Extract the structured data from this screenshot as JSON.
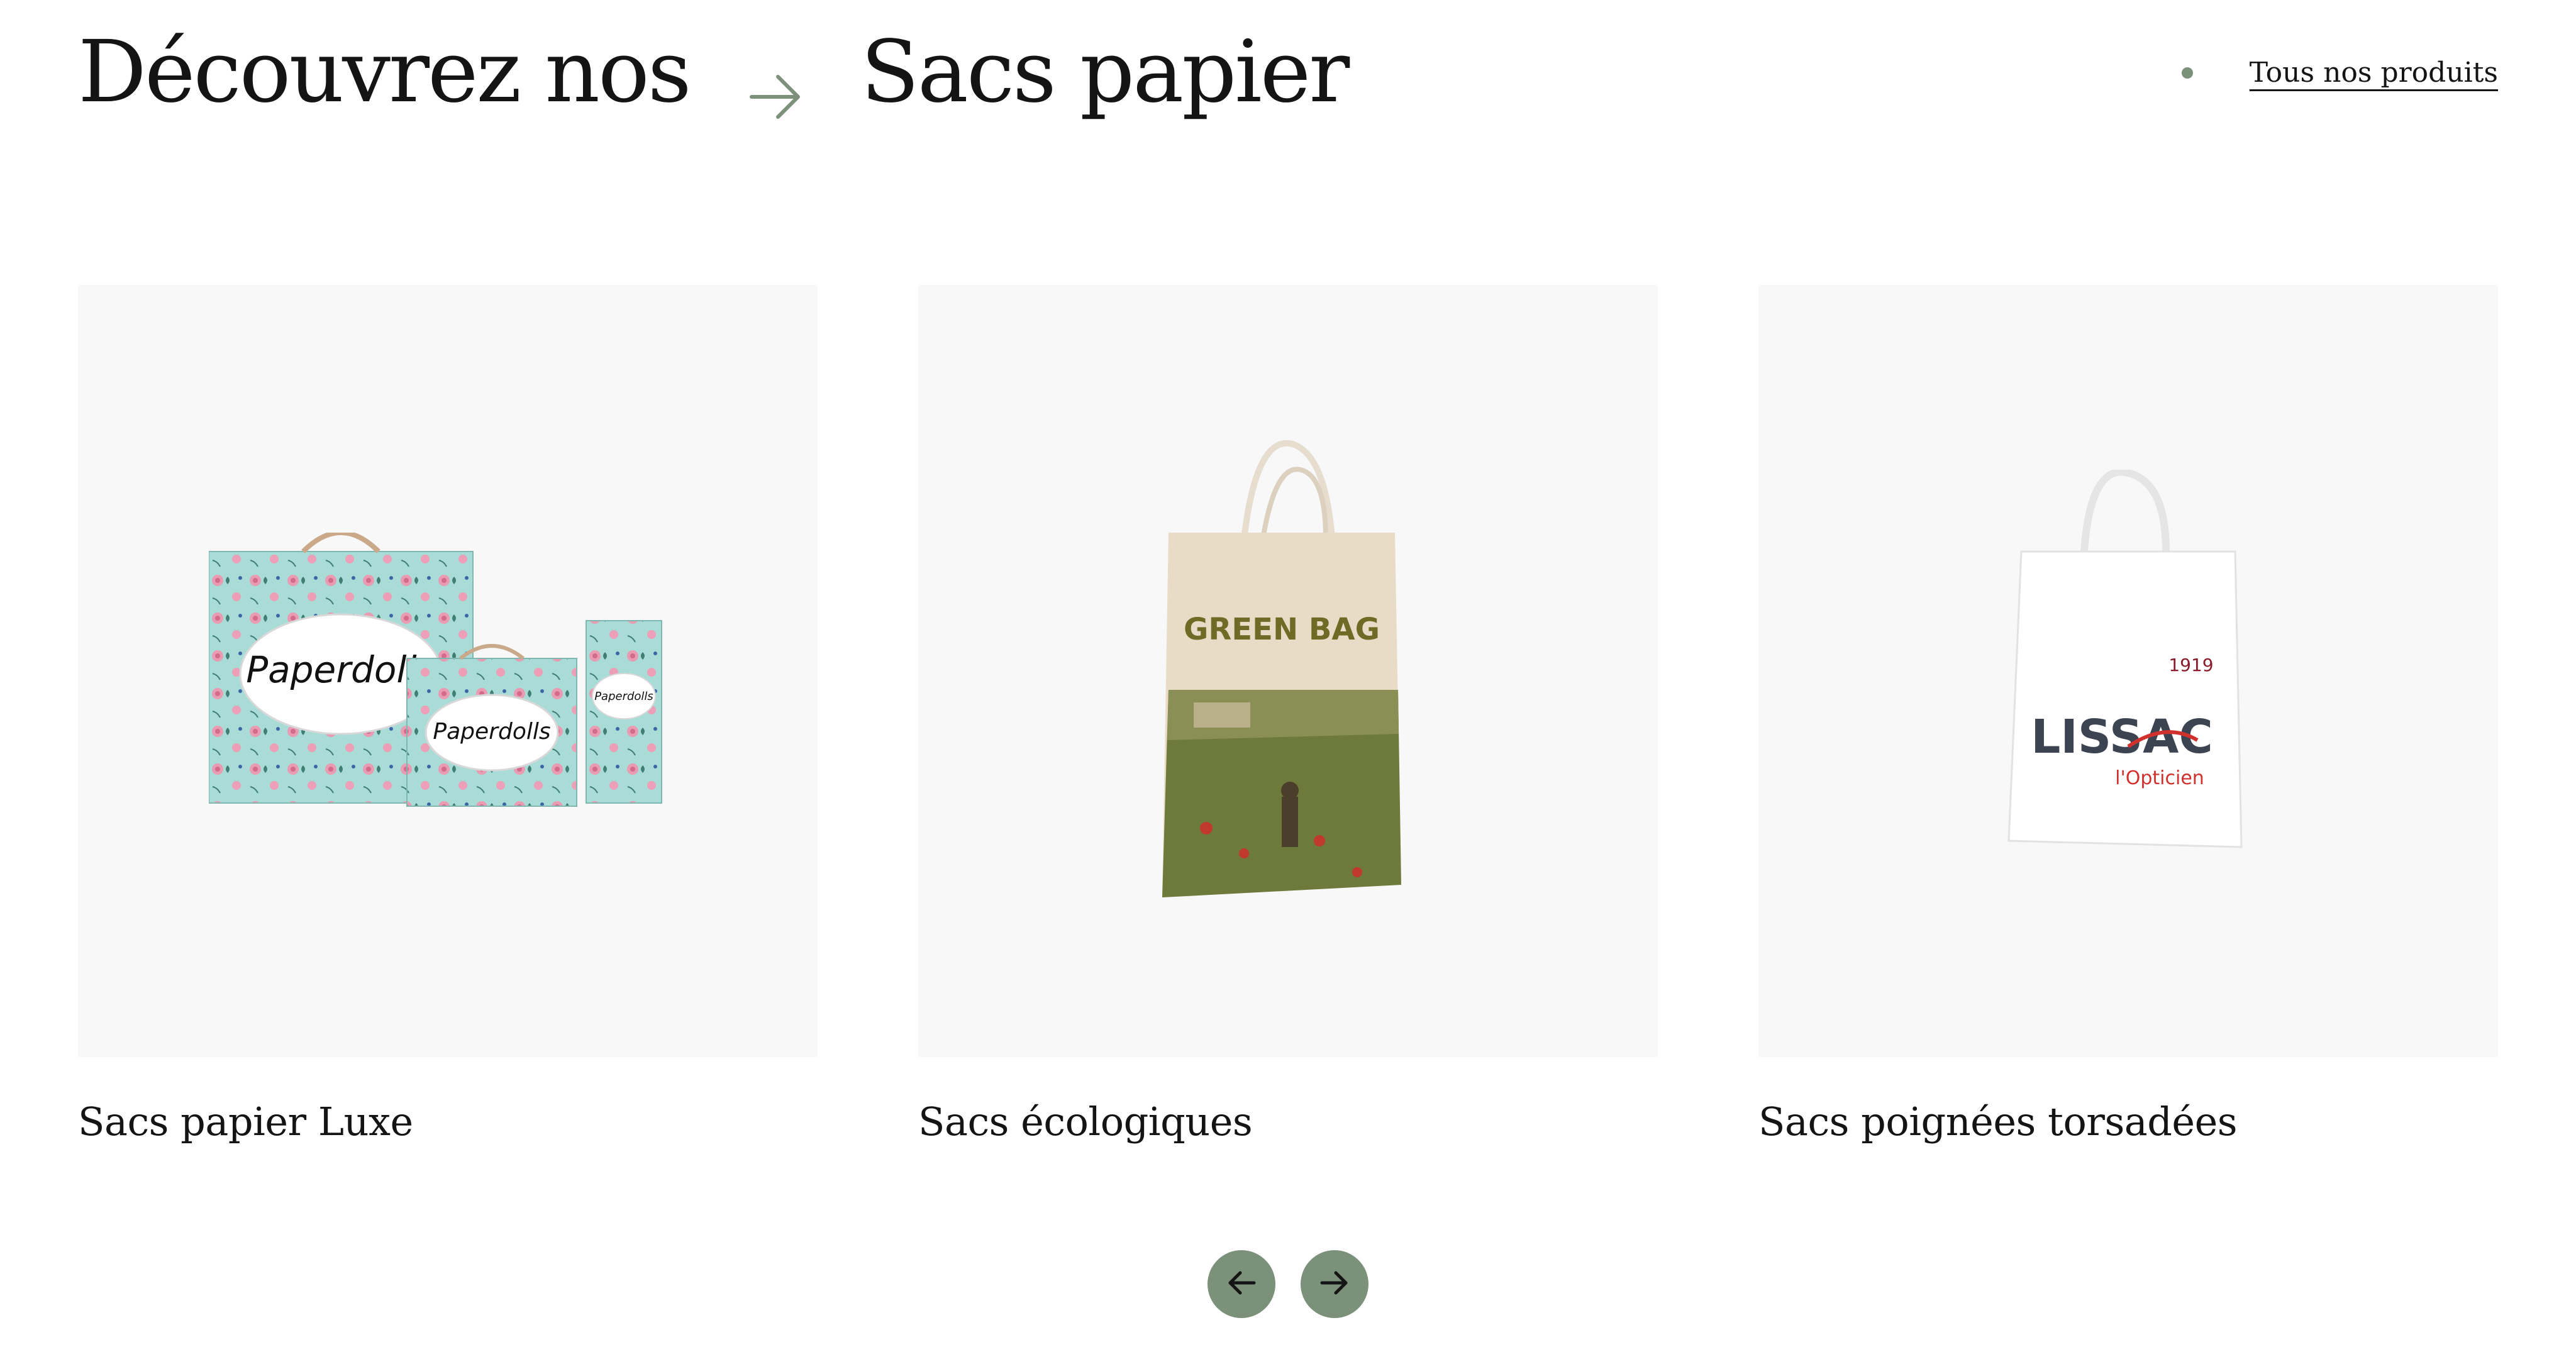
{
  "header": {
    "title_left": "Découvrez nos",
    "title_right": "Sacs papier",
    "arrow_icon": "arrow-right-icon",
    "all_products_label": "Tous nos produits"
  },
  "products": [
    {
      "label": "Sacs papier Luxe",
      "image_brand_large": "Paperdolls",
      "image_brand_medium": "Paperdolls",
      "image_brand_small": "Paperdolls"
    },
    {
      "label": "Sacs écologiques",
      "image_brand": "GREEN BAG"
    },
    {
      "label": "Sacs poignées torsadées",
      "image_brand": "LISSAC",
      "image_tagline": "l'Opticien",
      "image_year": "1919"
    }
  ],
  "navigation": {
    "prev_icon": "arrow-left-icon",
    "next_icon": "arrow-right-icon"
  },
  "colors": {
    "accent": "#7b917a",
    "text": "#141414",
    "card_background": "#f8f8f8"
  }
}
